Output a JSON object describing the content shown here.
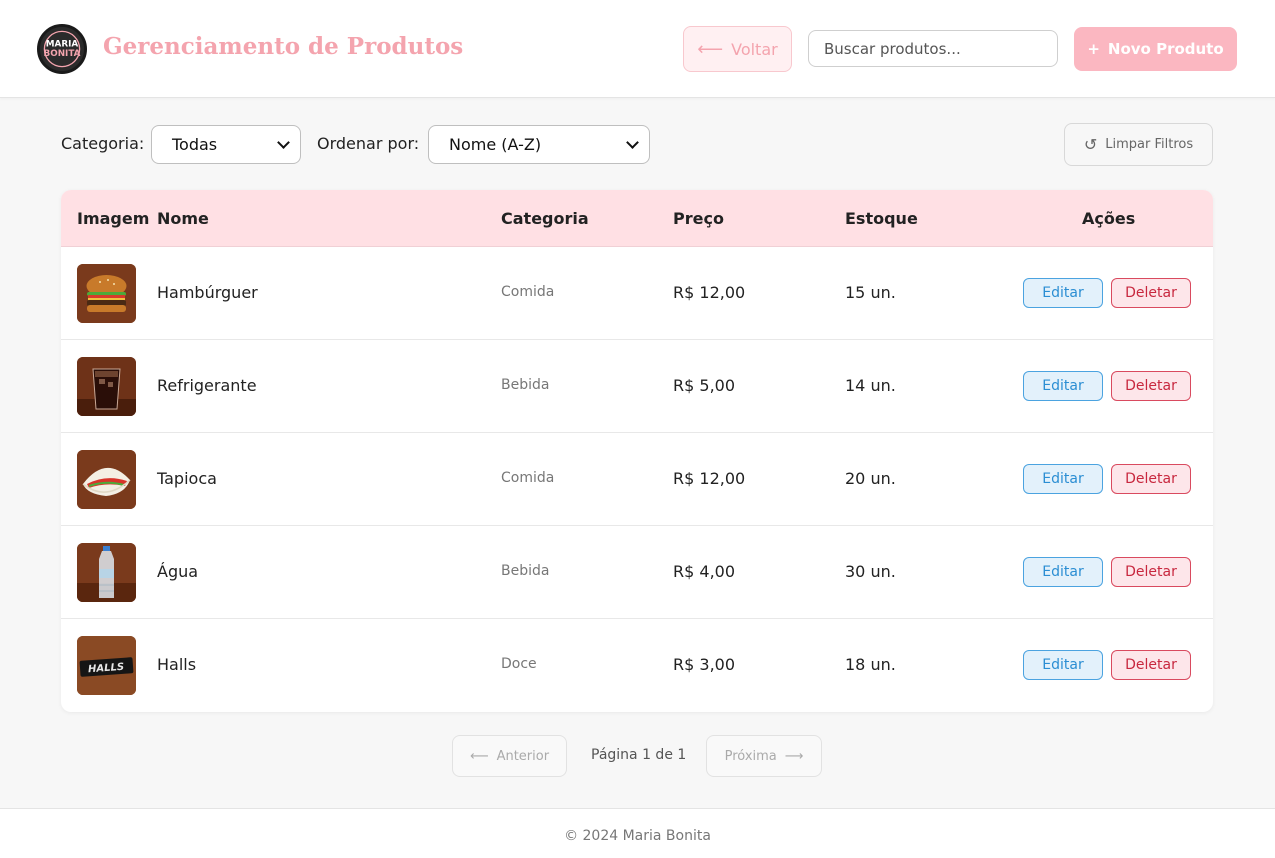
{
  "header": {
    "logo_text": "MARIA BONITA",
    "title": "Gerenciamento de Produtos",
    "back_label": "Voltar",
    "search_placeholder": "Buscar produtos...",
    "new_product_label": "Novo Produto",
    "accent_color": "#f4a4ae"
  },
  "filters": {
    "category_label": "Categoria:",
    "category_value": "Todas",
    "sort_label": "Ordenar por:",
    "sort_value": "Nome (A-Z)",
    "clear_label": "Limpar Filtros"
  },
  "table": {
    "columns": [
      "Imagem",
      "Nome",
      "Categoria",
      "Preço",
      "Estoque",
      "Ações"
    ],
    "edit_label": "Editar",
    "delete_label": "Deletar",
    "rows": [
      {
        "image": "hamburger-photo",
        "name": "Hambúrguer",
        "category": "Comida",
        "price": "R$ 12,00",
        "stock": "15 un."
      },
      {
        "image": "soda-photo",
        "name": "Refrigerante",
        "category": "Bebida",
        "price": "R$ 5,00",
        "stock": "14 un."
      },
      {
        "image": "tapioca-photo",
        "name": "Tapioca",
        "category": "Comida",
        "price": "R$ 12,00",
        "stock": "20 un."
      },
      {
        "image": "water-bottle-photo",
        "name": "Água",
        "category": "Bebida",
        "price": "R$ 4,00",
        "stock": "30 un."
      },
      {
        "image": "halls-candy-photo",
        "name": "Halls",
        "category": "Doce",
        "price": "R$ 3,00",
        "stock": "18 un."
      }
    ]
  },
  "pagination": {
    "prev_label": "Anterior",
    "info": "Página 1 de 1",
    "next_label": "Próxima"
  },
  "footer": {
    "text": "© 2024 Maria Bonita"
  }
}
